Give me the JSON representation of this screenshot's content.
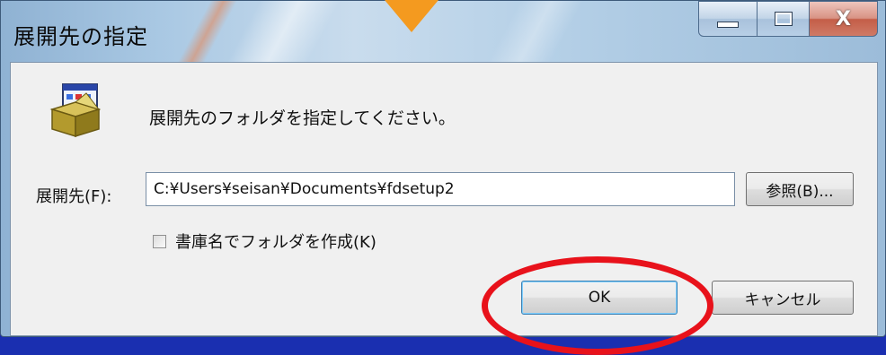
{
  "window": {
    "title": "展開先の指定",
    "close_glyph": "X"
  },
  "dialog": {
    "instruction": "展開先のフォルダを指定してください。",
    "destination_label": "展開先(F):",
    "destination_value": "C:¥Users¥seisan¥Documents¥fdsetup2",
    "browse_label": "参照(B)...",
    "checkbox_label": "書庫名でフォルダを作成(K)",
    "checkbox_checked": false,
    "ok_label": "OK",
    "cancel_label": "キャンセル"
  },
  "icons": {
    "app": "installer-box-icon",
    "minimize": "minimize-icon",
    "maximize": "maximize-icon",
    "close": "close-icon"
  },
  "colors": {
    "annotation_arrow": "#f49a1f",
    "annotation_ring": "#e8121b",
    "slide_background": "#1a2fb0"
  }
}
